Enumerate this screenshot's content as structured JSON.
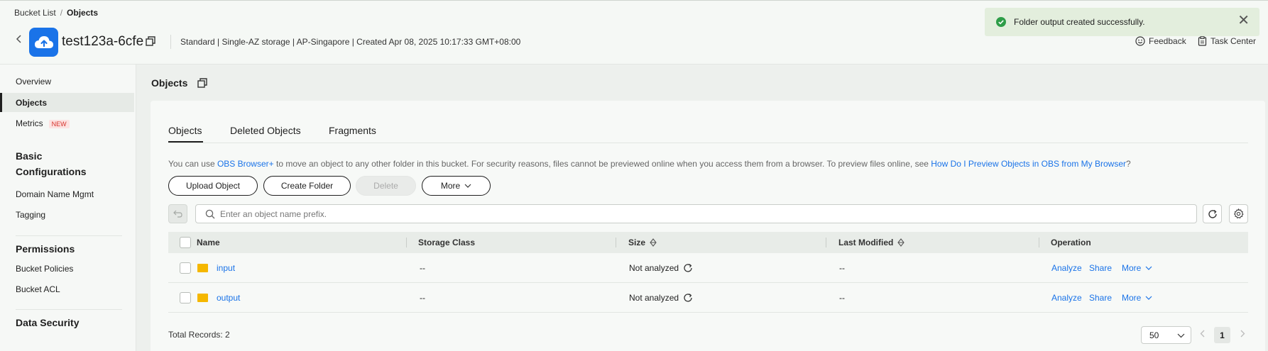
{
  "breadcrumb": {
    "root": "Bucket List",
    "separator": "/",
    "current": "Objects"
  },
  "bucket": {
    "name": "test123a-6cfe",
    "info": "Standard | Single-AZ storage | AP-Singapore | Created  Apr 08, 2025 10:17:33 GMT+08:00"
  },
  "header_actions": {
    "feedback": "Feedback",
    "task_center": "Task Center"
  },
  "toast": {
    "message": "Folder output created successfully.",
    "close": "✕"
  },
  "sidebar": {
    "overview": "Overview",
    "objects": "Objects",
    "metrics": "Metrics",
    "metrics_badge": "NEW",
    "basic_config_title": "Basic Configurations",
    "domain": "Domain Name Mgmt",
    "tagging": "Tagging",
    "permissions_title": "Permissions",
    "bucket_policies": "Bucket Policies",
    "bucket_acl": "Bucket ACL",
    "data_security_title": "Data Security"
  },
  "page": {
    "title": "Objects"
  },
  "tabs": [
    "Objects",
    "Deleted Objects",
    "Fragments"
  ],
  "active_tab": "Objects",
  "hint": {
    "prefix": "You can use ",
    "link1": "OBS Browser+",
    "middle": " to move an object to any other folder in this bucket. For security reasons, files cannot be previewed online when you access them from a browser. To preview files online, see ",
    "link2": "How Do I Preview Objects in OBS from My Browser",
    "suffix": "?"
  },
  "toolbar": {
    "upload": "Upload Object",
    "create_folder": "Create Folder",
    "delete": "Delete",
    "more": "More"
  },
  "search": {
    "placeholder": "Enter an object name prefix."
  },
  "table": {
    "headers": {
      "name": "Name",
      "storage_class": "Storage Class",
      "size": "Size",
      "last_modified": "Last Modified",
      "operation": "Operation"
    },
    "rows": [
      {
        "name": "input",
        "storage_class": "--",
        "size": "Not analyzed",
        "last_modified": "--",
        "analyze": "Analyze",
        "share": "Share",
        "more": "More"
      },
      {
        "name": "output",
        "storage_class": "--",
        "size": "Not analyzed",
        "last_modified": "--",
        "analyze": "Analyze",
        "share": "Share",
        "more": "More"
      }
    ]
  },
  "footer": {
    "total": "Total Records: 2",
    "page_size": "50",
    "current_page": "1"
  },
  "colors": {
    "accent": "#1a73e8",
    "success": "#2e9d48",
    "folder": "#f5b700",
    "toast_bg": "#e3eedd"
  },
  "icons": {
    "bucket": "cloud-upload-icon",
    "copy": "copy-icon",
    "feedback": "smile-icon",
    "task": "clipboard-icon",
    "success": "check-circle-icon",
    "search": "search-icon",
    "refresh": "refresh-icon",
    "settings": "gear-icon",
    "undo": "undo-icon",
    "folder": "folder-icon",
    "sort": "sort-icon",
    "chevron": "chevron-down-icon"
  }
}
